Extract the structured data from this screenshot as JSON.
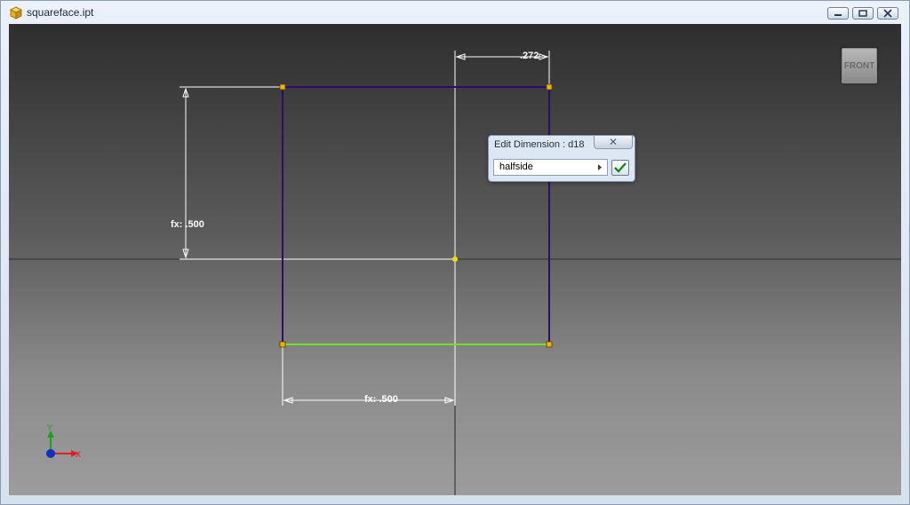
{
  "window": {
    "title": "squareface.ipt",
    "buttons": [
      "minimize",
      "restore",
      "close"
    ]
  },
  "viewcube": {
    "face_label": "FRONT"
  },
  "dimensions": {
    "top_offset": ".272",
    "left_height": "fx: .500",
    "bottom_width": "fx: .500"
  },
  "edit_dimension": {
    "title": "Edit Dimension : d18",
    "value": "halfside",
    "close_glyph": "✕"
  },
  "axis": {
    "x_label": "X",
    "y_label": "Y"
  },
  "colors": {
    "sketch_line": "#2a0f6a",
    "selected_line": "#70e020",
    "vertex": "#f0b400",
    "dimension_line": "#ffffff",
    "x_axis": "#e02020",
    "y_axis": "#20a020",
    "origin": "#1030c0"
  }
}
